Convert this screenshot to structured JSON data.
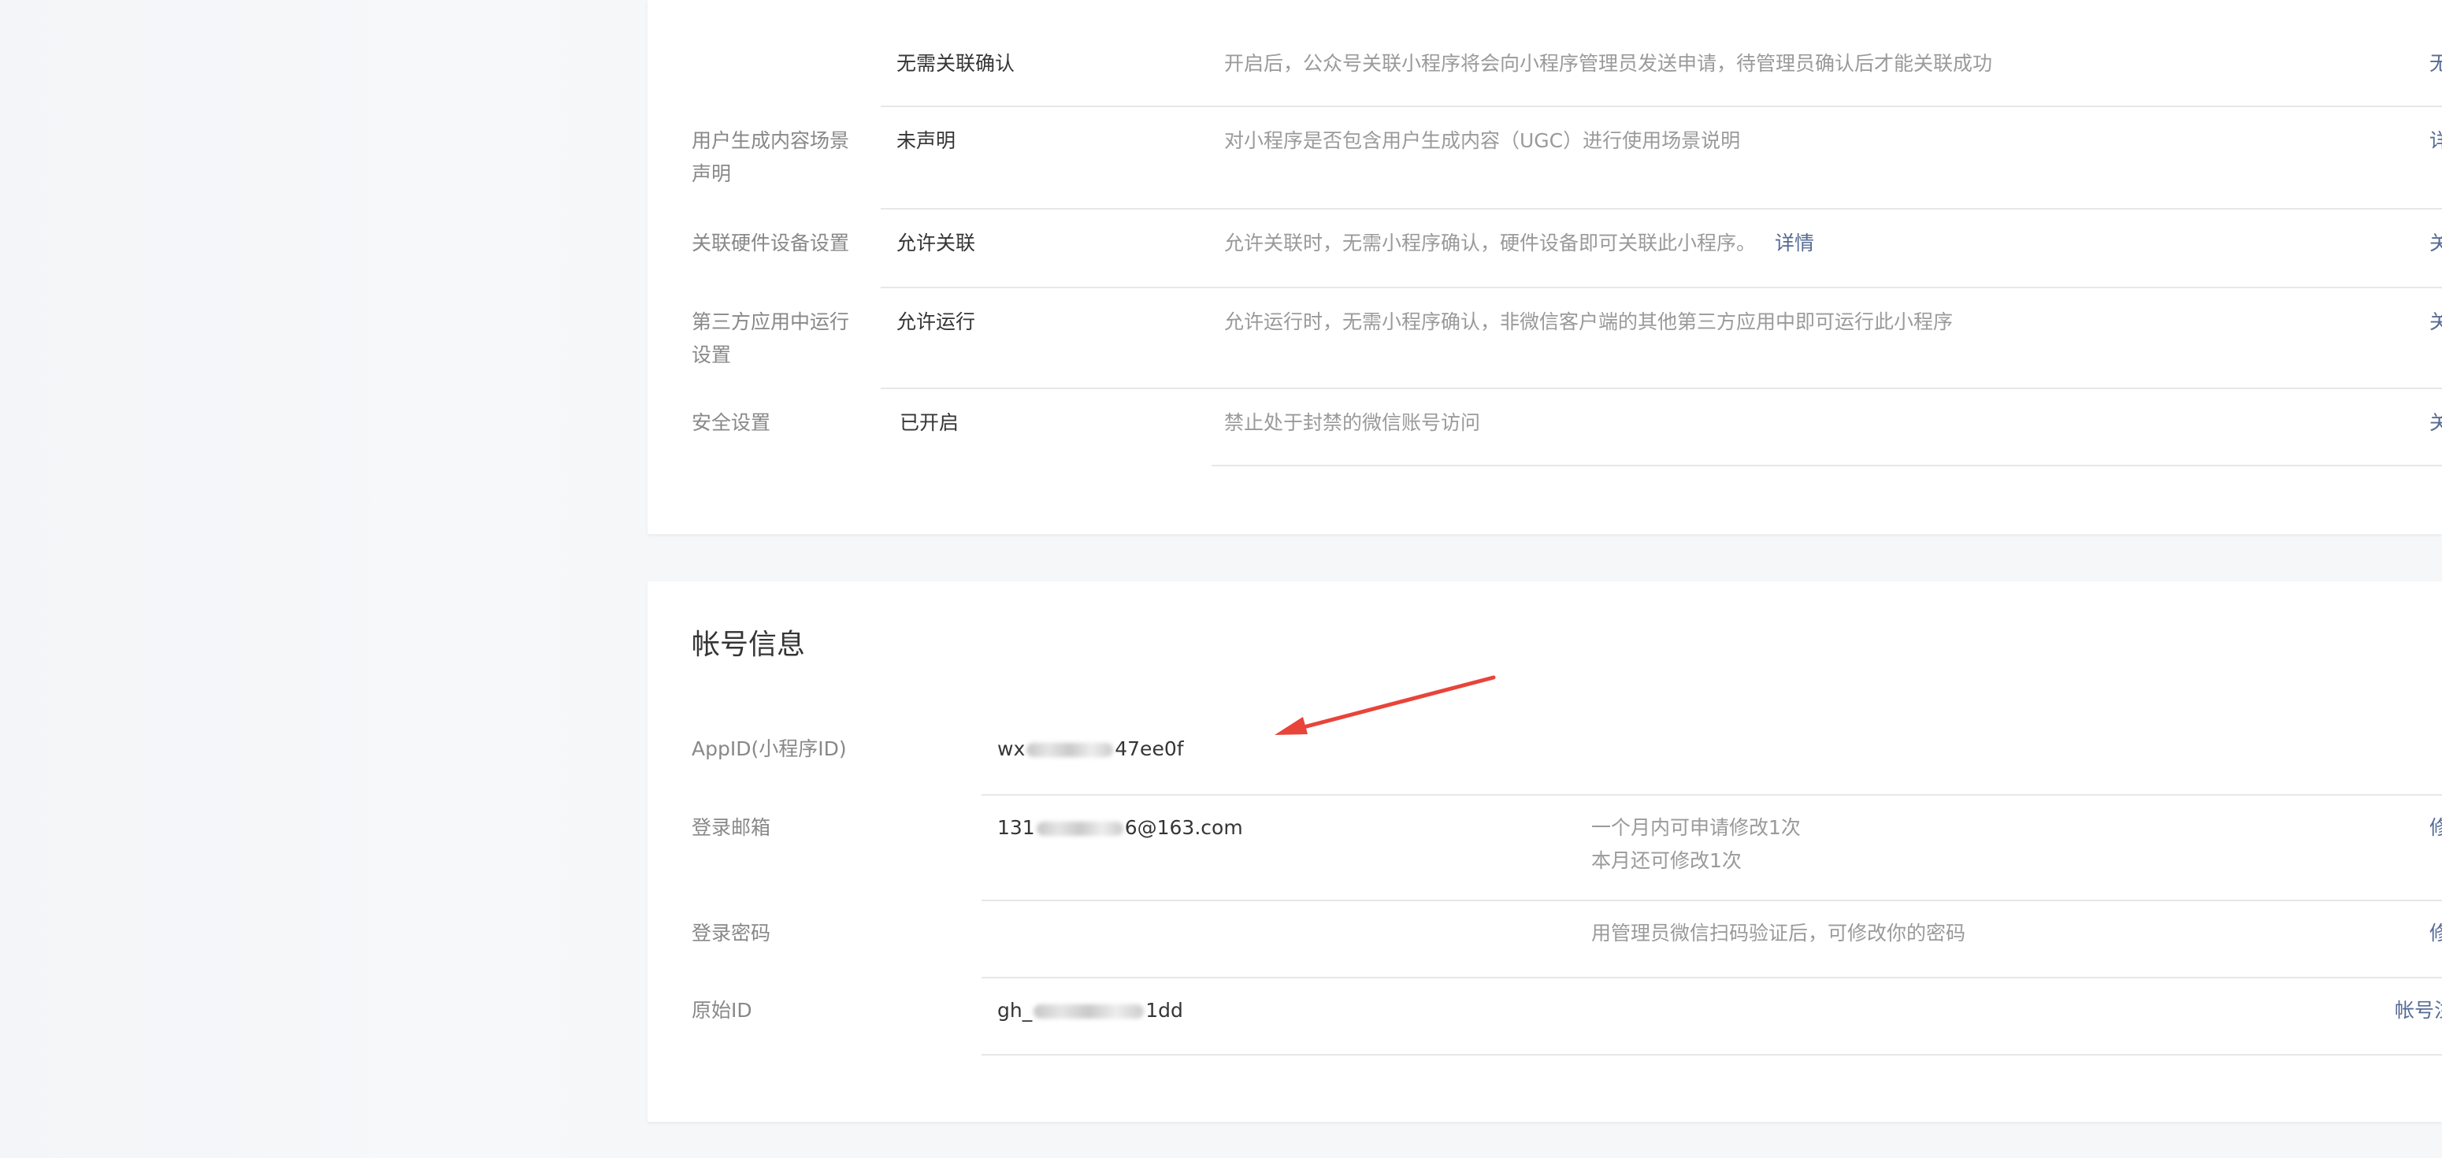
{
  "settings": {
    "rows": [
      {
        "label": "",
        "value": "无需关联确认",
        "desc": "开启后，公众号关联小程序将会向小程序管理员发送申请，待管理员确认后才能关联成功",
        "action": "无"
      },
      {
        "label_line1": "用户生成内容场景",
        "label_line2": "声明",
        "value": "未声明",
        "desc": "对小程序是否包含用户生成内容（UGC）进行使用场景说明",
        "action": "详"
      },
      {
        "label": "关联硬件设备设置",
        "value": "允许关联",
        "desc": "允许关联时，无需小程序确认，硬件设备即可关联此小程序。",
        "desc_link": "详情",
        "action": "关"
      },
      {
        "label_line1": "第三方应用中运行",
        "label_line2": "设置",
        "value": "允许运行",
        "desc": "允许运行时，无需小程序确认，非微信客户端的其他第三方应用中即可运行此小程序",
        "action": "关"
      },
      {
        "label": "安全设置",
        "value": "已开启",
        "desc": "禁止处于封禁的微信账号访问",
        "action": "关"
      }
    ]
  },
  "account": {
    "title": "帐号信息",
    "appid": {
      "label": "AppID(小程序ID)",
      "value_prefix": "wx",
      "value_suffix": "47ee0f"
    },
    "email": {
      "label": "登录邮箱",
      "value_prefix": "131",
      "value_suffix": "6@163.com",
      "desc_line1": "一个月内可申请修改1次",
      "desc_line2": "本月还可修改1次",
      "action": "修"
    },
    "password": {
      "label": "登录密码",
      "desc": "用管理员微信扫码验证后，可修改你的密码",
      "action": "修"
    },
    "original_id": {
      "label": "原始ID",
      "value_prefix": "gh_",
      "value_suffix": "1dd",
      "action": "帐号注"
    }
  },
  "colors": {
    "background": "#f6f7f9",
    "card": "#ffffff",
    "link": "#576b95",
    "annotation_arrow": "#e8443a"
  }
}
